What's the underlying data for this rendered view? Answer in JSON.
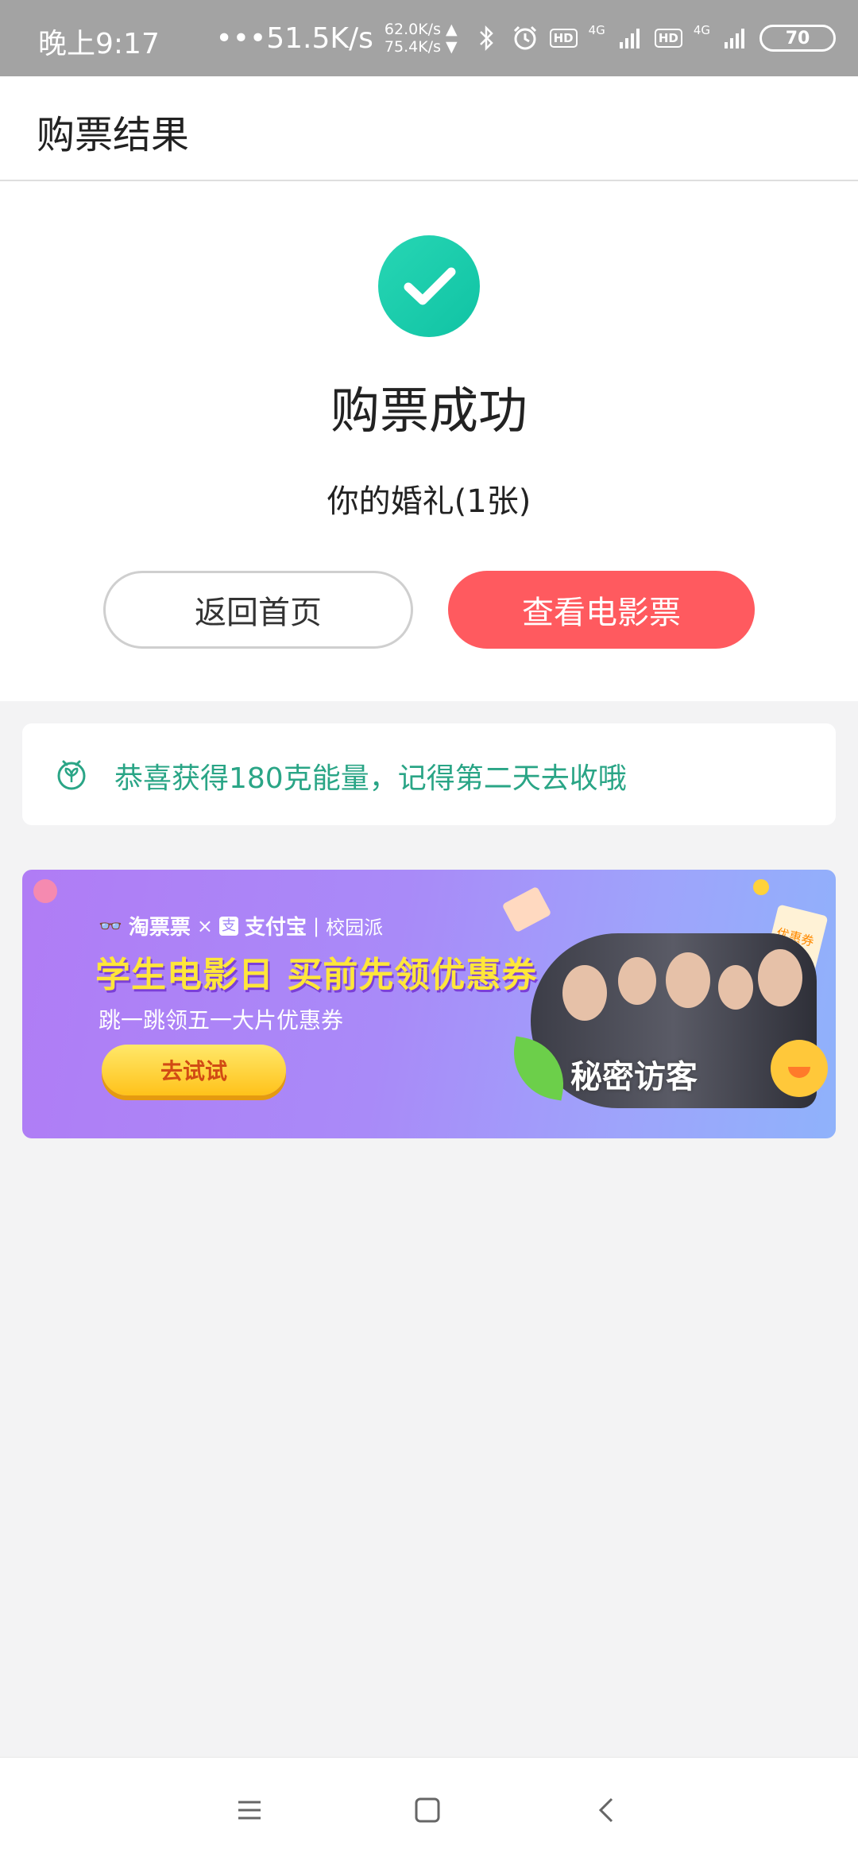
{
  "status_bar": {
    "time": "晚上9:17",
    "speed": "•••51.5K/s",
    "up_rate": "62.0K/s ▲",
    "down_rate": "75.4K/s ▼",
    "hd_label": "HD",
    "net_label": "4G",
    "battery": "70"
  },
  "header": {
    "title": "购票结果"
  },
  "result": {
    "title": "购票成功",
    "ticket_info": "你的婚礼(1张)",
    "home_button": "返回首页",
    "view_button": "查看电影票"
  },
  "energy": {
    "text": "恭喜获得180克能量，记得第二天去收哦"
  },
  "banner": {
    "brand_taopiaopiao": "淘票票",
    "brand_alipay": "支付宝",
    "brand_campus": "校园派",
    "title": "学生电影日 买前先领优惠券",
    "subtitle": "跳一跳领五一大片优惠券",
    "button": "去试试",
    "movie_title": "秘密访客",
    "coupon_tag": "优惠券"
  },
  "colors": {
    "accent_red": "#ff5a5f",
    "success_teal": "#1fcbae",
    "energy_green": "#2aa586"
  }
}
